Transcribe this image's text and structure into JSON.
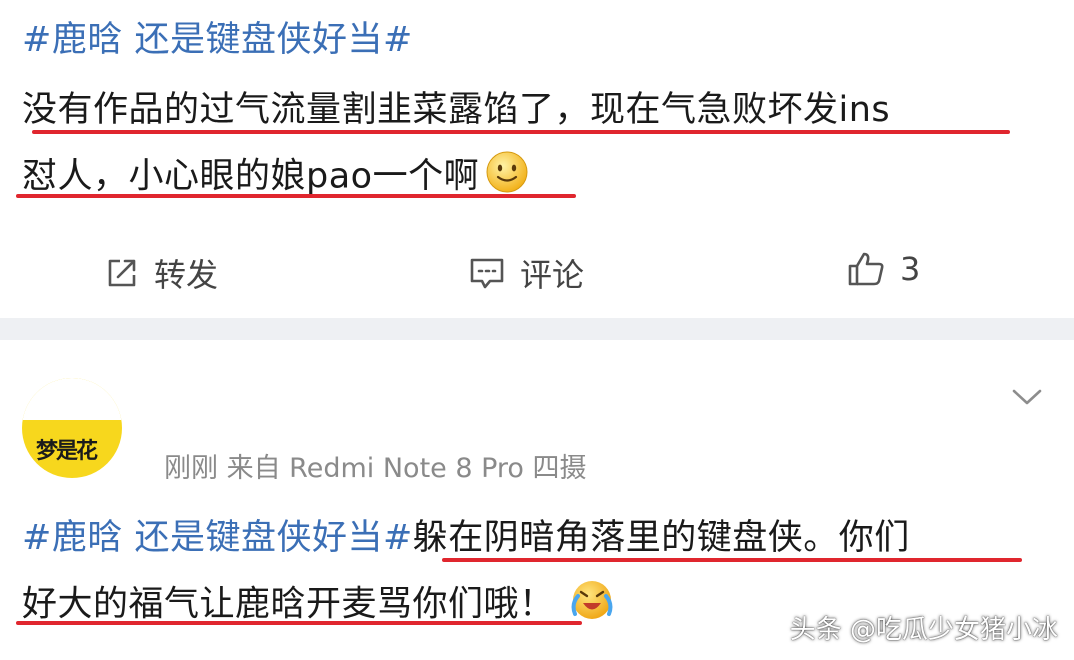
{
  "post1": {
    "topic": "#鹿晗 还是键盘侠好当#",
    "line1": "没有作品的过气流量割韭菜露馅了，现在气急败坏发ins",
    "line2": "怼人，小心眼的娘pao一个啊",
    "actions": {
      "repost_label": "转发",
      "comment_label": "评论",
      "like_count": "3"
    }
  },
  "post2": {
    "avatar_text": "梦是花",
    "meta": "刚刚  来自 Redmi Note 8 Pro 四摄",
    "topic": "#鹿晗 还是键盘侠好当#",
    "line1_rest": "躲在阴暗角落里的键盘侠。你们",
    "line2": "好大的福气让鹿晗开麦骂你们哦！"
  },
  "watermark": "头条 @吃瓜少女猪小冰",
  "colors": {
    "topic_blue": "#3b6fb6",
    "underline_red": "#e0262e",
    "avatar_yellow": "#f7d71d",
    "divider_gray": "#eef0f3"
  },
  "icons": [
    "repost-icon",
    "comment-icon",
    "like-icon",
    "chevron-down-icon",
    "smile-emoji",
    "crying-laugh-emoji"
  ]
}
